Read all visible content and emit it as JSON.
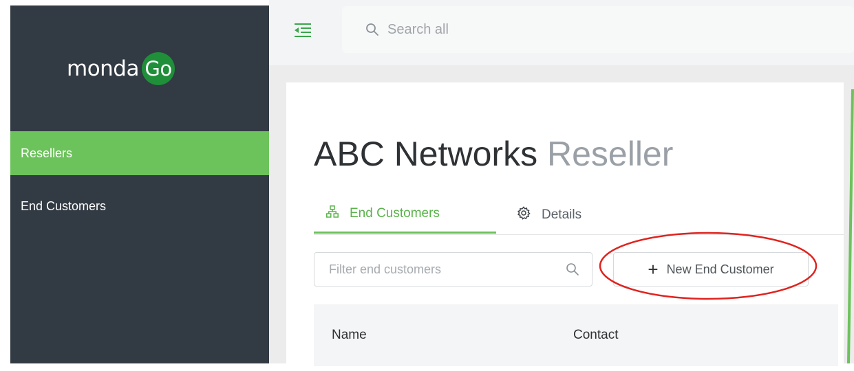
{
  "brand": {
    "logo_text": "monda",
    "logo_badge": "Go",
    "accent_color": "#6cc25b",
    "sidebar_color": "#323a43"
  },
  "sidebar": {
    "items": [
      {
        "label": "Resellers",
        "active": true
      },
      {
        "label": "End Customers",
        "active": false
      }
    ]
  },
  "topbar": {
    "menu_icon": "menu-collapse-icon",
    "search_placeholder": "Search all",
    "search_value": ""
  },
  "page": {
    "title_main": "ABC Networks",
    "title_muted": "Reseller"
  },
  "tabs": [
    {
      "label": "End Customers",
      "icon": "sitemap-icon",
      "active": true
    },
    {
      "label": "Details",
      "icon": "gear-icon",
      "active": false
    }
  ],
  "toolbar": {
    "filter_placeholder": "Filter end customers",
    "filter_value": "",
    "new_button_label": "New End Customer"
  },
  "table": {
    "columns": [
      "Name",
      "Contact"
    ]
  },
  "annotation": {
    "highlight_color": "#e0231e",
    "highlight_target": "New End Customer"
  }
}
